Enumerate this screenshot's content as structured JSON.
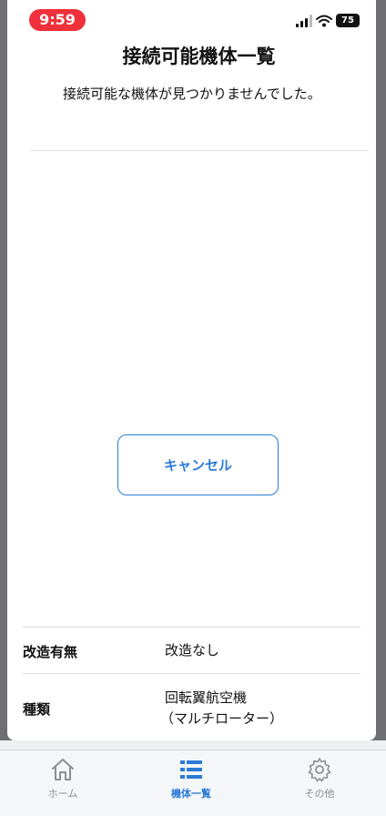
{
  "status_bar": {
    "time": "9:59",
    "battery": "75"
  },
  "sheet": {
    "title": "接続可能機体一覧",
    "message": "接続可能な機体が見つかりませんでした。",
    "cancel_label": "キャンセル"
  },
  "details": [
    {
      "label": "改造有無",
      "value": "改造なし",
      "value2": ""
    },
    {
      "label": "種類",
      "value": "回転翼航空機",
      "value2": "（マルチローター）"
    }
  ],
  "tabs": [
    {
      "label": "ホーム",
      "icon": "home-icon",
      "active": false
    },
    {
      "label": "機体一覧",
      "icon": "list-icon",
      "active": true
    },
    {
      "label": "その他",
      "icon": "gear-icon",
      "active": false
    }
  ],
  "colors": {
    "accent": "#2b7bd6",
    "time_pill": "#f0303a",
    "inactive": "#8a8f98"
  }
}
